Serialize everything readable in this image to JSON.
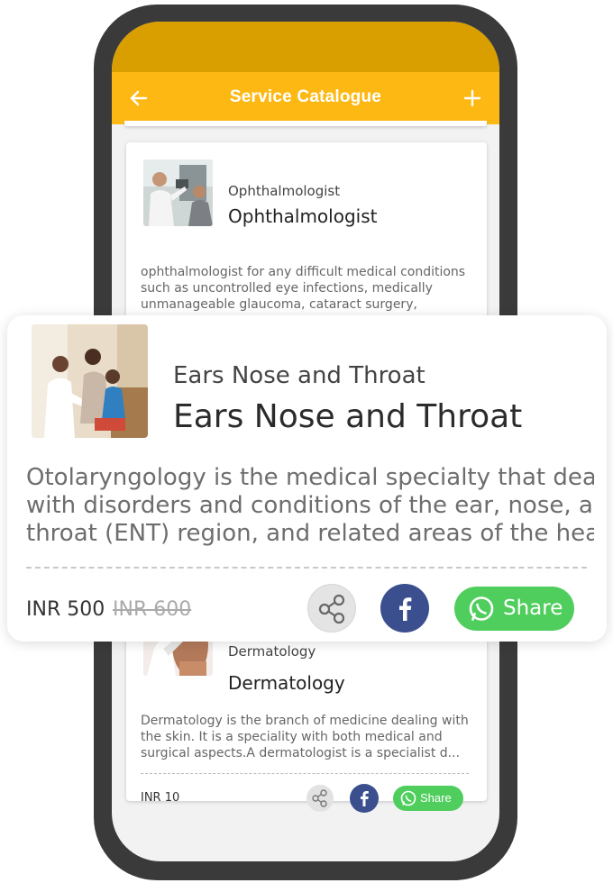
{
  "app": {
    "title": "Service Catalogue",
    "accent": "#fdb813",
    "status_bar_color": "#d99f00"
  },
  "services": [
    {
      "category": "Ophthalmologist",
      "name": "Ophthalmologist",
      "desc_lines": [
        "ophthalmologist for any difficult medical conditions",
        "such as uncontrolled eye infections, medically",
        "unmanageable glaucoma, cataract surgery, cornea..."
      ],
      "image": "eye-exam-photo"
    },
    {
      "category": "Ears Nose and Throat",
      "name": "Ears Nose and Throat",
      "desc_lines": [
        "Otolaryngology is the medical specialty that deals",
        "with disorders and conditions of the ear, nose, and",
        "throat (ENT) region, and related areas of the head ..."
      ],
      "price": "INR 500",
      "old_price": "INR 600",
      "share_label": "Share",
      "image": "doctor-family-photo"
    },
    {
      "category": "Dermatology",
      "name": "Dermatology",
      "desc_lines": [
        "Dermatology is the branch of medicine dealing with",
        "the skin. It is a speciality with both medical and",
        "surgical aspects.A dermatologist is a specialist d..."
      ],
      "price": "INR 10",
      "share_label": "Share",
      "image": "skin-care-photo"
    }
  ],
  "colors": {
    "facebook": "#3b4f8f",
    "whatsapp": "#4fce5d"
  }
}
